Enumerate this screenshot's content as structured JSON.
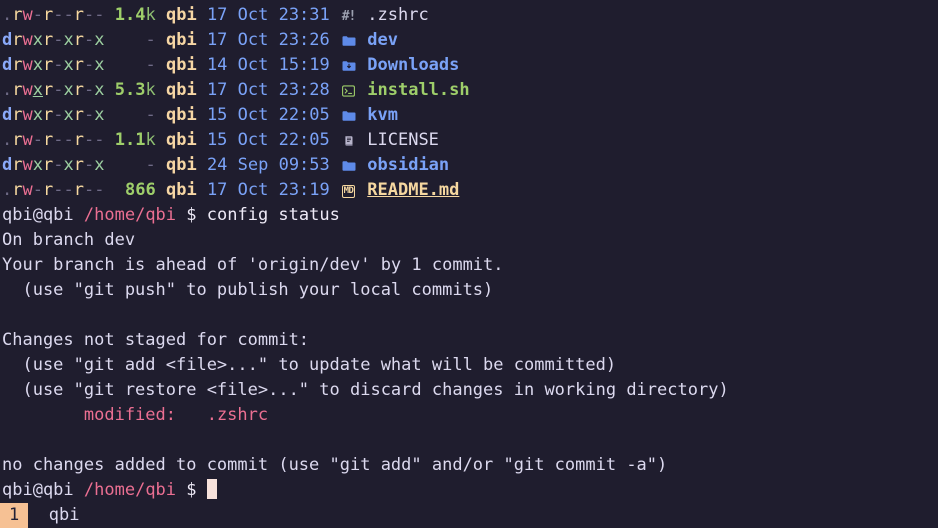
{
  "terminal": {
    "background": "#1f1d2e",
    "foreground": "#e0def4",
    "cursor_color": "#f7e2dc"
  },
  "listing": {
    "command_style": "eza -l",
    "rows": [
      {
        "permissions": ".rw-r--r--",
        "size": "1.4",
        "size_unit": "k",
        "owner": "qbi",
        "day": "17",
        "month": "Oct",
        "time": "23:31",
        "icon": "shebang-icon",
        "icon_glyph": "#!",
        "name": ".zshrc",
        "kind": "plain"
      },
      {
        "permissions": "drwxr-xr-x",
        "size": "-",
        "size_unit": "",
        "owner": "qbi",
        "day": "17",
        "month": "Oct",
        "time": "23:26",
        "icon": "folder-icon",
        "icon_glyph": "",
        "name": "dev",
        "kind": "directory"
      },
      {
        "permissions": "drwxr-xr-x",
        "size": "-",
        "size_unit": "",
        "owner": "qbi",
        "day": "14",
        "month": "Oct",
        "time": "15:19",
        "icon": "folder-download-icon",
        "icon_glyph": "",
        "name": "Downloads",
        "kind": "directory"
      },
      {
        "permissions": ".rwxr-xr-x",
        "size": "5.3",
        "size_unit": "k",
        "owner": "qbi",
        "day": "17",
        "month": "Oct",
        "time": "23:28",
        "icon": "terminal-script-icon",
        "icon_glyph": "",
        "name": "install.sh",
        "kind": "executable"
      },
      {
        "permissions": "drwxr-xr-x",
        "size": "-",
        "size_unit": "",
        "owner": "qbi",
        "day": "15",
        "month": "Oct",
        "time": "22:05",
        "icon": "folder-icon",
        "icon_glyph": "",
        "name": "kvm",
        "kind": "directory"
      },
      {
        "permissions": ".rw-r--r--",
        "size": "1.1",
        "size_unit": "k",
        "owner": "qbi",
        "day": "15",
        "month": "Oct",
        "time": "22:05",
        "icon": "license-book-icon",
        "icon_glyph": "",
        "name": "LICENSE",
        "kind": "plain"
      },
      {
        "permissions": "drwxr-xr-x",
        "size": "-",
        "size_unit": "",
        "owner": "qbi",
        "day": "24",
        "month": "Sep",
        "time": "09:53",
        "icon": "folder-icon",
        "icon_glyph": "",
        "name": "obsidian",
        "kind": "directory"
      },
      {
        "permissions": ".rw-r--r--",
        "size": "866",
        "size_unit": "",
        "owner": "qbi",
        "day": "17",
        "month": "Oct",
        "time": "23:19",
        "icon": "markdown-icon",
        "icon_glyph": "MD",
        "name": "README.md",
        "kind": "document"
      }
    ]
  },
  "prompt": {
    "user_host": "qbi@qbi",
    "path": "/home/qbi",
    "sigil": "$",
    "command": "config status"
  },
  "git_status": {
    "branch_line": "On branch dev",
    "ahead_line": "Your branch is ahead of 'origin/dev' by 1 commit.",
    "push_hint": "  (use \"git push\" to publish your local commits)",
    "not_staged_header": "Changes not staged for commit:",
    "add_hint": "  (use \"git add <file>...\" to update what will be committed)",
    "restore_hint": "  (use \"git restore <file>...\" to discard changes in working directory)",
    "modified_label": "        modified:",
    "modified_file": "   .zshrc",
    "no_changes_line": "no changes added to commit (use \"git add\" and/or \"git commit -a\")"
  },
  "prompt2": {
    "user_host": "qbi@qbi",
    "path": "/home/qbi",
    "sigil": "$"
  },
  "statusbar": {
    "window_index": "1",
    "window_name": "qbi",
    "index_background": "#f6c194",
    "index_foreground": "#232136"
  }
}
